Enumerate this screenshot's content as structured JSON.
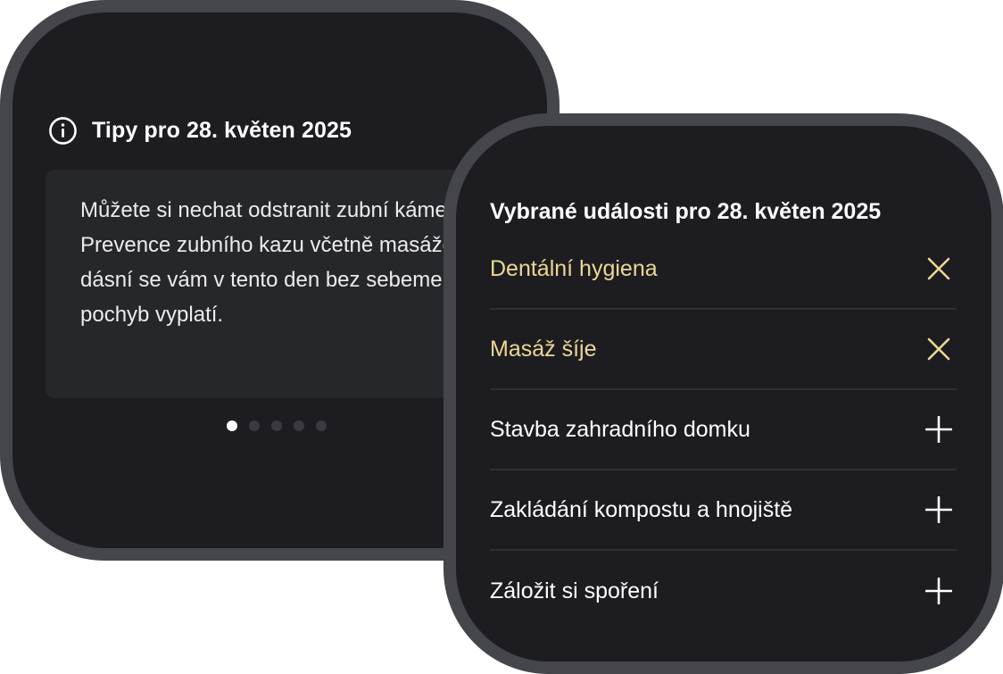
{
  "tips": {
    "icon": "info-icon",
    "title": "Tipy pro 28. květen 2025",
    "text": "Můžete si nechat odstranit zubní kámen. Prevence zubního kazu včetně masáže dásní se vám v tento den bez sebemenších pochyb vyplatí.",
    "pagination": {
      "total": 5,
      "current": 1
    }
  },
  "events": {
    "title": "Vybrané události pro 28. květen 2025",
    "items": [
      {
        "label": "Dentální hygiena",
        "selected": true,
        "action_icon": "close-icon"
      },
      {
        "label": "Masáž šíje",
        "selected": true,
        "action_icon": "close-icon"
      },
      {
        "label": "Stavba zahradního domku",
        "selected": false,
        "action_icon": "plus-icon"
      },
      {
        "label": "Zakládání kompostu a hnojiště",
        "selected": false,
        "action_icon": "plus-icon"
      },
      {
        "label": "Záložit si spoření",
        "selected": false,
        "action_icon": "plus-icon"
      }
    ]
  },
  "colors": {
    "card_background": "#1d1d21",
    "card_border": "#45464b",
    "tips_box_background": "#26272b",
    "selected_text": "#ecd795",
    "text": "#ffffff"
  }
}
